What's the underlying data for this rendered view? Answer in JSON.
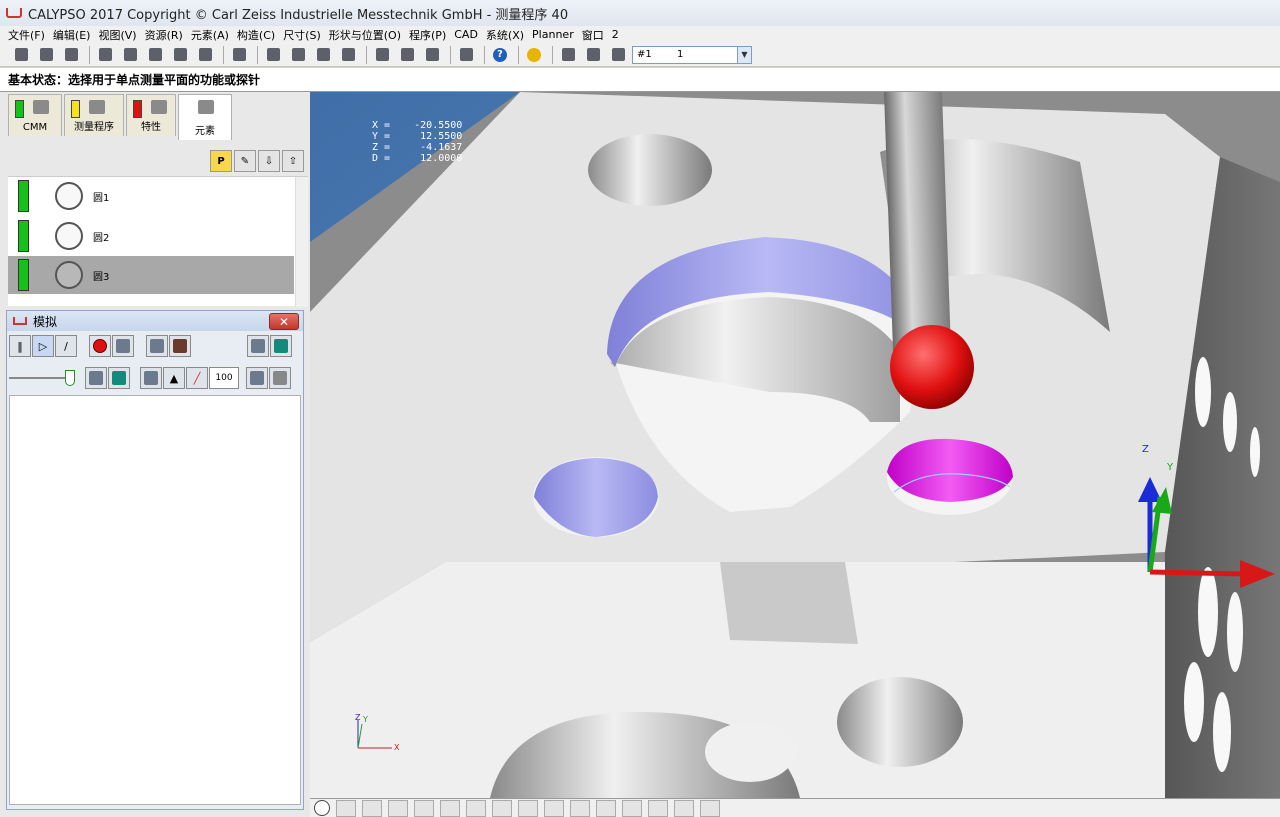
{
  "window": {
    "title": "CALYPSO 2017 Copyright © Carl Zeiss Industrielle Messtechnik GmbH - 测量程序 40"
  },
  "menu": [
    "文件(F)",
    "编辑(E)",
    "视图(V)",
    "资源(R)",
    "元素(A)",
    "构造(C)",
    "尺寸(S)",
    "形状与位置(O)",
    "程序(P)",
    "CAD",
    "系统(X)",
    "Planner",
    "窗口",
    "2"
  ],
  "toolbar": {
    "combo_left": "#1",
    "combo_right": "1"
  },
  "status_line": "基本状态：选择用于单点测量平面的功能或探针",
  "tabs": [
    {
      "label": "CMM",
      "flag": "#16c21a"
    },
    {
      "label": "测量程序",
      "flag": "#f5e21a"
    },
    {
      "label": "特性",
      "flag": "#e01010"
    },
    {
      "label": "元素",
      "flag": ""
    }
  ],
  "element_list": [
    {
      "name": "圆1",
      "flag": "#16c21a"
    },
    {
      "name": "圆2",
      "flag": "#16c21a"
    },
    {
      "name": "圆3",
      "flag": "#16c21a"
    }
  ],
  "sim": {
    "title": "模拟",
    "close": "✕",
    "speed": "100"
  },
  "viewport": {
    "coords": [
      "X =    -20.5500",
      "Y =     12.5500",
      "Z =     -4.1637",
      "D =     12.0000"
    ],
    "axes": {
      "x": "X",
      "y": "Y",
      "z": "Z"
    }
  },
  "colors": {
    "probe": "#e01010",
    "highlight": "#e020e0",
    "bore": "#9b9cef"
  }
}
